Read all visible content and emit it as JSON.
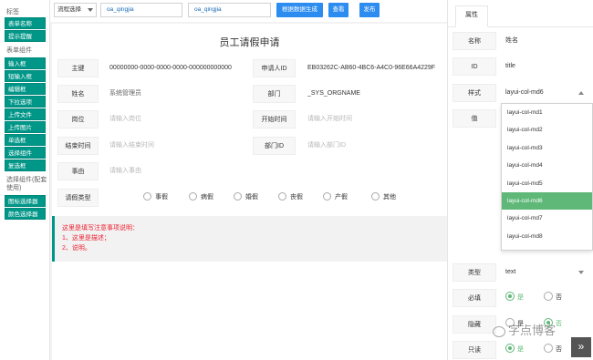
{
  "sidebar": {
    "section1": "标签",
    "group1": [
      "表单名称",
      "提示提醒"
    ],
    "section2": "表单组件",
    "group2": [
      "输入框",
      "短输入框",
      "编辑框",
      "下拉选项",
      "上传文件",
      "上传图片",
      "单选框",
      "选择组件",
      "复选框"
    ],
    "section3": "选择组件(配套使用)",
    "group3": [
      "图标选择器",
      "颜色选择器"
    ]
  },
  "topbar": {
    "flow_select": "流程选择",
    "field1": "oa_qingjia",
    "field2": "oa_qingjia",
    "generate_btn": "根据数据生成",
    "view_btn": "查看",
    "publish_btn": "发布"
  },
  "form": {
    "title": "员工请假申请",
    "rows": [
      {
        "l1": "主键",
        "v1": "00000000-0000-0000-0000-000000000000",
        "v1_ph": false,
        "l2": "申请人ID",
        "v2": "EB03262C-AB60-4BC6-A4C0-96E66A4229F",
        "v2_ph": false
      },
      {
        "l1": "姓名",
        "v1": "系统管理员",
        "v1_ph": false,
        "l2": "部门",
        "v2": "_SYS_ORGNAME",
        "v2_ph": false
      },
      {
        "l1": "岗位",
        "v1": "请输入岗位",
        "v1_ph": true,
        "l2": "开始时间",
        "v2": "请输入开始时间",
        "v2_ph": true
      },
      {
        "l1": "结束时间",
        "v1": "请输入结束时间",
        "v1_ph": true,
        "l2": "部门ID",
        "v2": "请输入部门ID",
        "v2_ph": true
      }
    ],
    "reason_label": "事由",
    "reason_placeholder": "请输入事由",
    "leave_type_label": "请假类型",
    "leave_types": [
      "事假",
      "病假",
      "婚假",
      "丧假",
      "产假",
      "其他"
    ],
    "notice": [
      "这里是填写注意事项说明：",
      "1、这里是描述；",
      "2、说明。"
    ]
  },
  "panel": {
    "tab": "属性",
    "name_label": "名称",
    "name_value": "姓名",
    "id_label": "ID",
    "id_value": "title",
    "style_label": "样式",
    "style_value": "layui-col-md6",
    "value_label": "值",
    "style_options": [
      "layui-col-md1",
      "layui-col-md2",
      "layui-col-md3",
      "layui-col-md4",
      "layui-col-md5",
      "layui-col-md6",
      "layui-col-md7",
      "layui-col-md8"
    ],
    "style_selected_index": 5,
    "type_label": "类型",
    "type_value": "text",
    "required_label": "必填",
    "hidden_label": "隐藏",
    "readonly_label": "只读",
    "yes": "是",
    "no": "否",
    "required_selected": "是",
    "hidden_selected": "否",
    "readonly_selected": "是"
  },
  "watermark": "字点博客",
  "expand_icon": "»",
  "colors": {
    "teal": "#009688",
    "green": "#5fb878",
    "blue": "#2d8cf0",
    "red": "#e22233"
  }
}
